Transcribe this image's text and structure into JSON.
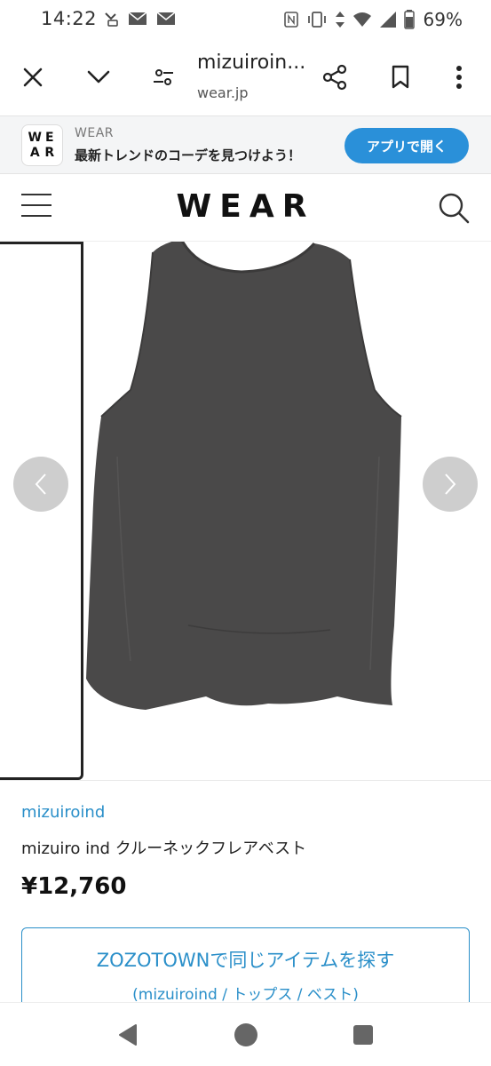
{
  "status_bar": {
    "time": "14:22",
    "battery": "69%",
    "icons_left": [
      "missed-call-icon",
      "mail-icon",
      "mail-icon"
    ],
    "icons_right": [
      "nfc-icon",
      "vibrate-icon",
      "data-arrows-icon",
      "wifi-icon",
      "signal-icon",
      "battery-icon"
    ]
  },
  "browser": {
    "page_title": "mizuiroin...",
    "domain": "wear.jp"
  },
  "app_banner": {
    "logo_letters": [
      "W",
      "E",
      "A",
      "R"
    ],
    "brand": "WEAR",
    "tagline": "最新トレンドのコーデを見つけよう！",
    "open_button": "アプリで開く"
  },
  "site_header": {
    "logo": "WEAR"
  },
  "product": {
    "brand": "mizuiroind",
    "name": "mizuiro ind クルーネックフレアベスト",
    "price": "¥12,760",
    "zozo_button": {
      "main": "ZOZOTOWNで同じアイテムを探す",
      "sub": "(mizuiroind / トップス / ベスト)"
    }
  },
  "colors": {
    "accent": "#2a8fc9",
    "button_blue": "#2a90d9",
    "garment": "#4a4949"
  }
}
